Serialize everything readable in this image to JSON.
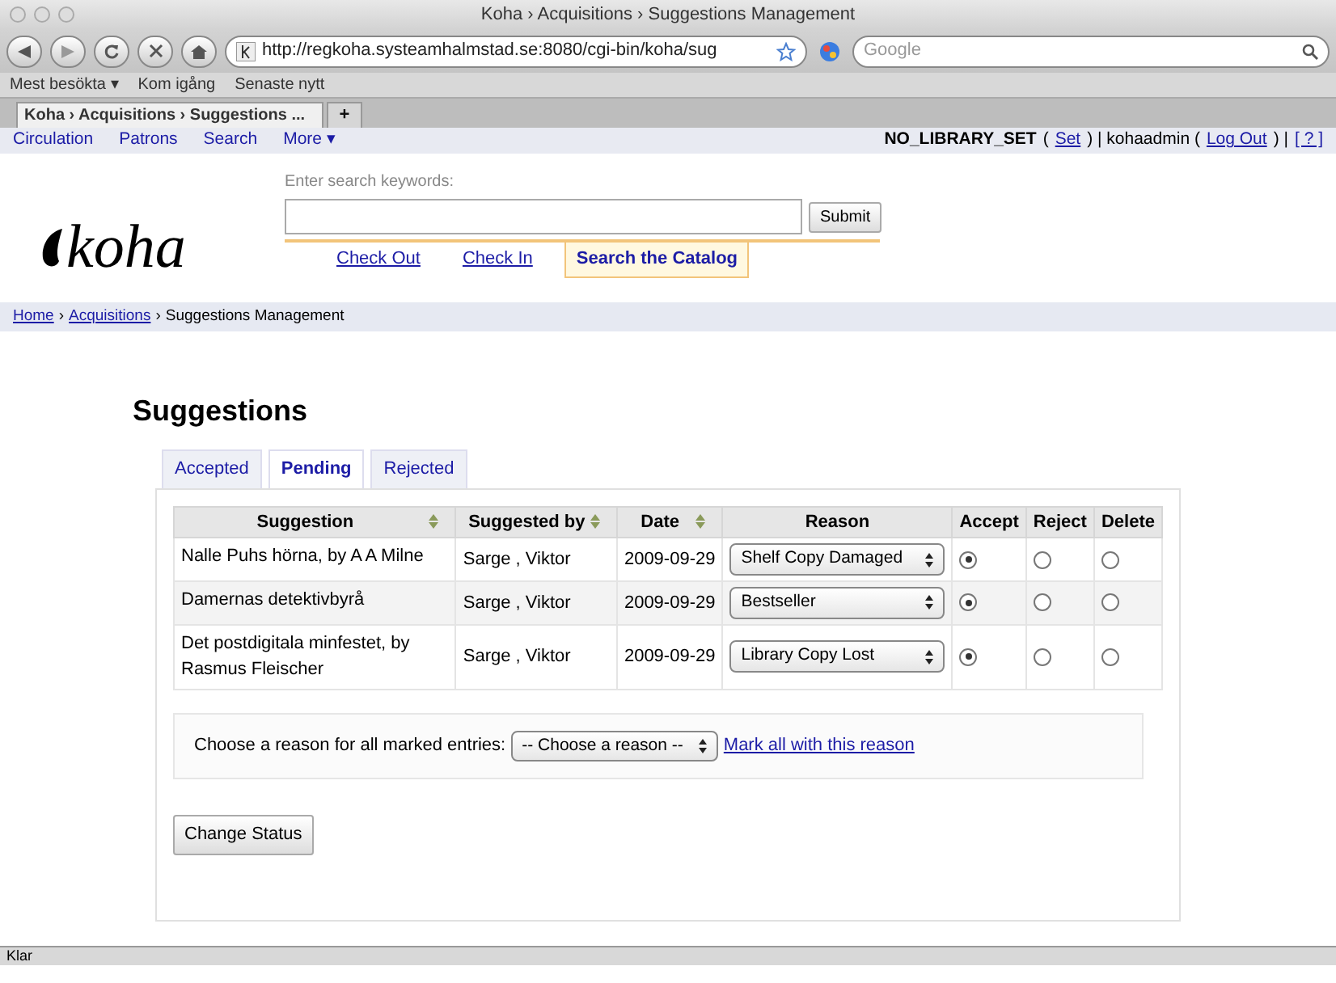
{
  "window": {
    "title": "Koha › Acquisitions › Suggestions Management"
  },
  "toolbar": {
    "url": "http://regkoha.systeamhalmstad.se:8080/cgi-bin/koha/sug",
    "search_placeholder": "Google"
  },
  "bookmarks": [
    "Mest besökta ▾",
    "Kom igång",
    "Senaste nytt"
  ],
  "browser_tabs": [
    {
      "label": "Koha › Acquisitions › Suggestions ...",
      "selected": true
    }
  ],
  "new_tab": "+",
  "nav": [
    "Circulation",
    "Patrons",
    "Search",
    "More ▾"
  ],
  "login": [
    {
      "kind": "bold",
      "text": "NO_LIBRARY_SET"
    },
    {
      "kind": "text",
      "text": "("
    },
    {
      "kind": "link",
      "text": "Set"
    },
    {
      "kind": "text",
      "text": ") | kohaadmin ("
    },
    {
      "kind": "link",
      "text": "Log Out"
    },
    {
      "kind": "text",
      "text": ") |"
    },
    {
      "kind": "link",
      "text": "[ ? ]"
    }
  ],
  "logo": "koha",
  "search": {
    "label": "Enter search keywords:",
    "button": "Submit"
  },
  "search_tabs": [
    {
      "label": "Check Out",
      "selected": false
    },
    {
      "label": "Check In",
      "selected": false
    },
    {
      "label": "Search the Catalog",
      "selected": true
    }
  ],
  "breadcrumb": [
    {
      "kind": "link",
      "text": "Home"
    },
    {
      "kind": "sep",
      "text": "›"
    },
    {
      "kind": "link",
      "text": "Acquisitions"
    },
    {
      "kind": "sep",
      "text": "›"
    },
    {
      "kind": "text",
      "text": "Suggestions Management"
    }
  ],
  "heading": "Suggestions",
  "tabs": [
    {
      "label": "Accepted",
      "selected": false
    },
    {
      "label": "Pending",
      "selected": true
    },
    {
      "label": "Rejected",
      "selected": false
    }
  ],
  "table": {
    "columns": [
      {
        "label": "Suggestion",
        "sortable": true
      },
      {
        "label": "Suggested by",
        "sortable": true
      },
      {
        "label": "Date",
        "sortable": true
      },
      {
        "label": "Reason",
        "sortable": false
      },
      {
        "label": "Accept",
        "sortable": false
      },
      {
        "label": "Reject",
        "sortable": false
      },
      {
        "label": "Delete",
        "sortable": false
      }
    ],
    "rows": [
      {
        "suggestion": "Nalle Puhs hörna, by A A Milne",
        "suggested_by": "Sarge , Viktor",
        "date": "2009-09-29",
        "reason": "Shelf Copy Damaged",
        "accept": true,
        "reject": false,
        "delete": false
      },
      {
        "suggestion": "Damernas detektivbyrå",
        "suggested_by": "Sarge , Viktor",
        "date": "2009-09-29",
        "reason": "Bestseller",
        "accept": true,
        "reject": false,
        "delete": false
      },
      {
        "suggestion": "Det postdigitala minfestet, by Rasmus Fleischer",
        "suggested_by": "Sarge , Viktor",
        "date": "2009-09-29",
        "reason": "Library Copy Lost",
        "accept": true,
        "reject": false,
        "delete": false
      }
    ]
  },
  "mark_all": {
    "label": "Choose a reason for all marked entries:",
    "select": "-- Choose a reason --",
    "link": "Mark all with this reason"
  },
  "change_status": "Change Status",
  "status_bar": "Klar"
}
